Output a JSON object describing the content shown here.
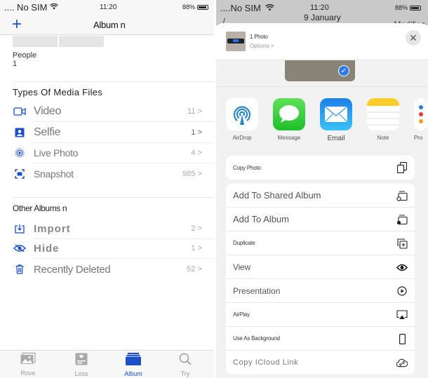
{
  "left": {
    "status": {
      "carrier": ".... No SIM",
      "time": "11:20",
      "battery": "88%"
    },
    "nav": {
      "add_symbol": "+",
      "title": "Album n"
    },
    "people": {
      "label": "People",
      "count": "1"
    },
    "media_types": {
      "title": "Types Of Media Files",
      "items": [
        {
          "icon": "video-icon",
          "label": "Video",
          "count": "11 >"
        },
        {
          "icon": "selfie-icon",
          "label": "Selfie",
          "count": "1 >"
        },
        {
          "icon": "live-photo-icon",
          "label": "Live Photo",
          "count": "4 >"
        },
        {
          "icon": "snapshot-icon",
          "label": "Snapshot",
          "count": "985 >"
        }
      ]
    },
    "other_albums": {
      "title": "Other Albums n",
      "items": [
        {
          "icon": "import-icon",
          "label": "Import",
          "count": "2 >"
        },
        {
          "icon": "hidden-icon",
          "label": "Hide",
          "count": "1 >"
        },
        {
          "icon": "trash-icon",
          "label": "Recently Deleted",
          "count": "52 >"
        }
      ]
    },
    "tabs": [
      {
        "icon": "photos-tab-icon",
        "label": "Rove",
        "active": false
      },
      {
        "icon": "for-you-tab-icon",
        "label": "Loss",
        "active": false
      },
      {
        "icon": "albums-tab-icon",
        "label": "Album",
        "active": true
      },
      {
        "icon": "search-tab-icon",
        "label": "Try",
        "active": false
      }
    ],
    "accent": "#1a4fc9"
  },
  "right": {
    "status": {
      "carrier": "....No SIM",
      "time": "11:20",
      "battery": "88%"
    },
    "nav": {
      "date": "9 January",
      "edit": "Modifica"
    },
    "sheet": {
      "title": "1 Photo",
      "options": "Options >",
      "close_symbol": "✕"
    },
    "apps": [
      {
        "name": "airdrop",
        "label": "AirDrop"
      },
      {
        "name": "message",
        "label": "Message"
      },
      {
        "name": "email",
        "label": "Email"
      },
      {
        "name": "note",
        "label": "Note"
      },
      {
        "name": "reminders",
        "label": "Pro"
      }
    ],
    "actions_group1": [
      {
        "label": "Copy Photo",
        "icon": "copy-icon"
      }
    ],
    "actions_group2": [
      {
        "label": "Add To Shared Album",
        "icon": "shared-album-icon"
      },
      {
        "label": "Add To Album",
        "icon": "add-album-icon"
      },
      {
        "label": "Duplicate",
        "icon": "duplicate-icon"
      },
      {
        "label": "View",
        "icon": "eye-icon"
      },
      {
        "label": "Presentation",
        "icon": "play-icon"
      },
      {
        "label": "AirPlay",
        "icon": "airplay-icon"
      },
      {
        "label": "Use As Background",
        "icon": "phone-icon"
      },
      {
        "label": "Copy ICloud Link",
        "icon": "cloud-link-icon"
      }
    ]
  }
}
